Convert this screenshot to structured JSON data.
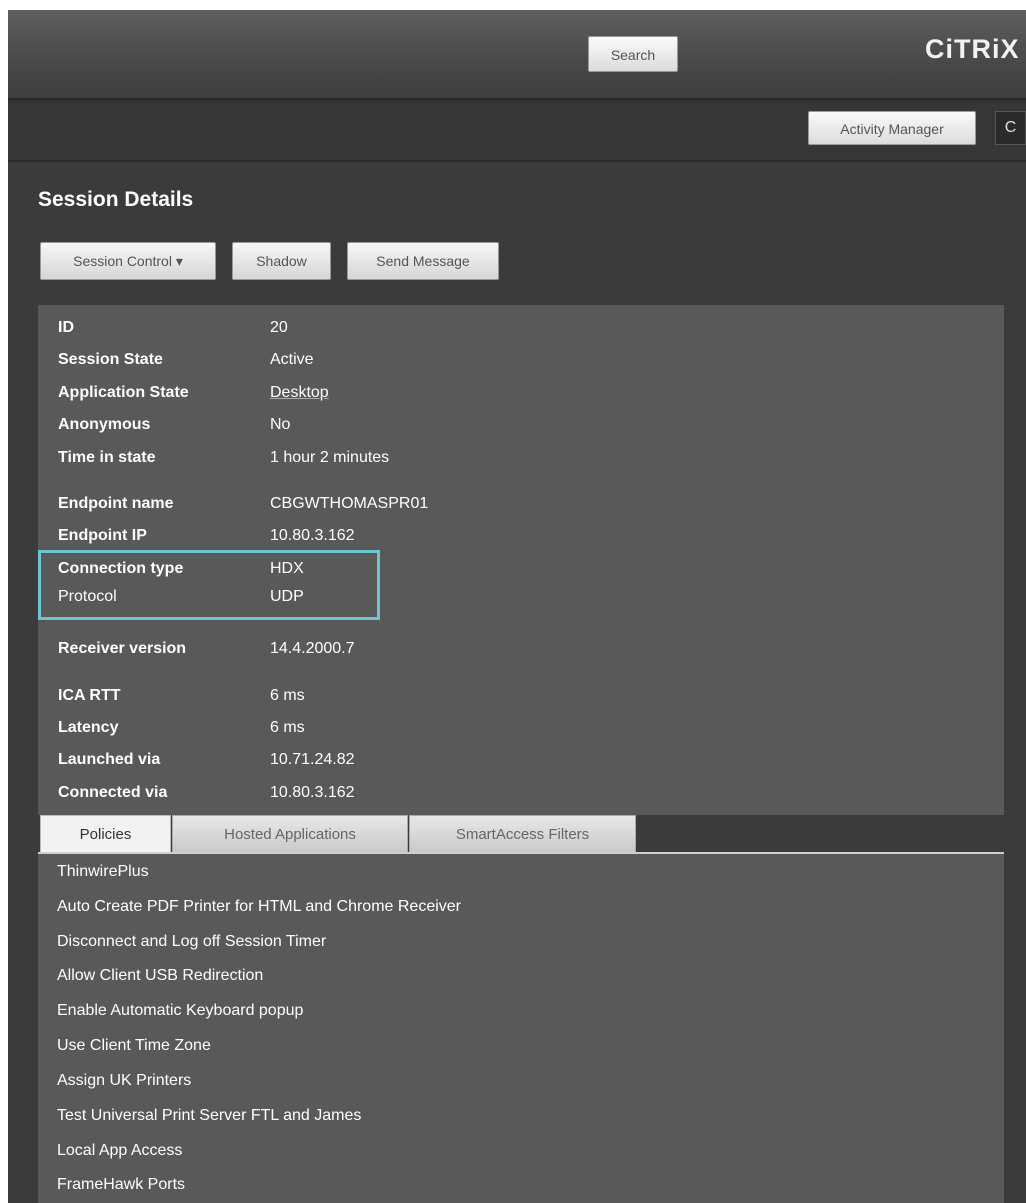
{
  "header": {
    "search_label": "Search",
    "logo_text": "CiTRiX",
    "activity_manager_label": "Activity Manager",
    "refresh_glyph": "C"
  },
  "page": {
    "title": "Session Details"
  },
  "toolbar": {
    "session_control_label": "Session Control ▾",
    "shadow_label": "Shadow",
    "send_message_label": "Send Message"
  },
  "details": [
    {
      "label": "ID",
      "value": "20"
    },
    {
      "label": "Session State",
      "value": "Active"
    },
    {
      "label": "Application State",
      "value": "Desktop"
    },
    {
      "label": "Anonymous",
      "value": "No"
    },
    {
      "label": "Time in state",
      "value": "1 hour 2 minutes"
    },
    {
      "label": "Endpoint name",
      "value": "CBGWTHOMASPR01"
    },
    {
      "label": "Endpoint IP",
      "value": "10.80.3.162"
    },
    {
      "label": "Connection type",
      "value": "HDX"
    },
    {
      "label": "Protocol",
      "value": "UDP"
    },
    {
      "label": "Receiver version",
      "value": "14.4.2000.7"
    },
    {
      "label": "ICA RTT",
      "value": "6 ms"
    },
    {
      "label": "Latency",
      "value": "6 ms"
    },
    {
      "label": "Launched via",
      "value": "10.71.24.82"
    },
    {
      "label": "Connected via",
      "value": "10.80.3.162"
    }
  ],
  "tabs": [
    {
      "label": "Policies",
      "active": true
    },
    {
      "label": "Hosted Applications",
      "active": false
    },
    {
      "label": "SmartAccess Filters",
      "active": false
    }
  ],
  "policies": [
    "ThinwirePlus",
    "Auto Create PDF Printer for HTML and Chrome Receiver",
    "Disconnect and Log off Session Timer",
    "Allow Client USB Redirection",
    "Enable Automatic Keyboard popup",
    "Use Client Time Zone",
    "Assign UK Printers",
    "Test Universal Print Server FTL and James",
    "Local App Access",
    "FrameHawk Ports"
  ],
  "colors": {
    "highlight": "#6cc6cf",
    "panel": "#595959",
    "background": "#3b3b3b"
  }
}
